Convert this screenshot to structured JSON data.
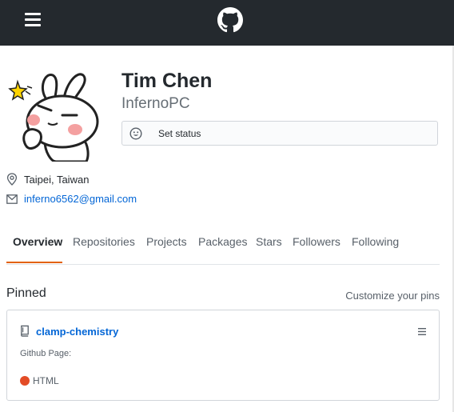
{
  "header": {
    "menu_icon": "hamburger-menu-icon",
    "logo_icon": "github-octocat-logo",
    "background": "#24292e"
  },
  "profile": {
    "full_name": "Tim Chen",
    "username": "InfernoPC",
    "status_placeholder": "Set status",
    "status_icon": "smiley-icon",
    "location": "Taipei, Taiwan",
    "location_icon": "location-pin-icon",
    "email": "inferno6562@gmail.com",
    "email_icon": "mail-icon"
  },
  "tabs": [
    {
      "label": "Overview",
      "active": true
    },
    {
      "label": "Repositories",
      "active": false
    },
    {
      "label": "Projects",
      "active": false
    },
    {
      "label": "Packages",
      "active": false
    },
    {
      "label": "Stars",
      "active": false
    },
    {
      "label": "Followers",
      "active": false
    },
    {
      "label": "Following",
      "active": false
    }
  ],
  "pinned": {
    "title": "Pinned",
    "customize_label": "Customize your pins",
    "items": [
      {
        "name": "clamp-chemistry",
        "description": "Github Page:",
        "language": "HTML",
        "language_color": "#e34c26",
        "repo_icon": "repo-book-icon",
        "drag_icon": "grabber-icon"
      }
    ]
  },
  "colors": {
    "accent_underline": "#e36209",
    "link": "#0366d6"
  }
}
